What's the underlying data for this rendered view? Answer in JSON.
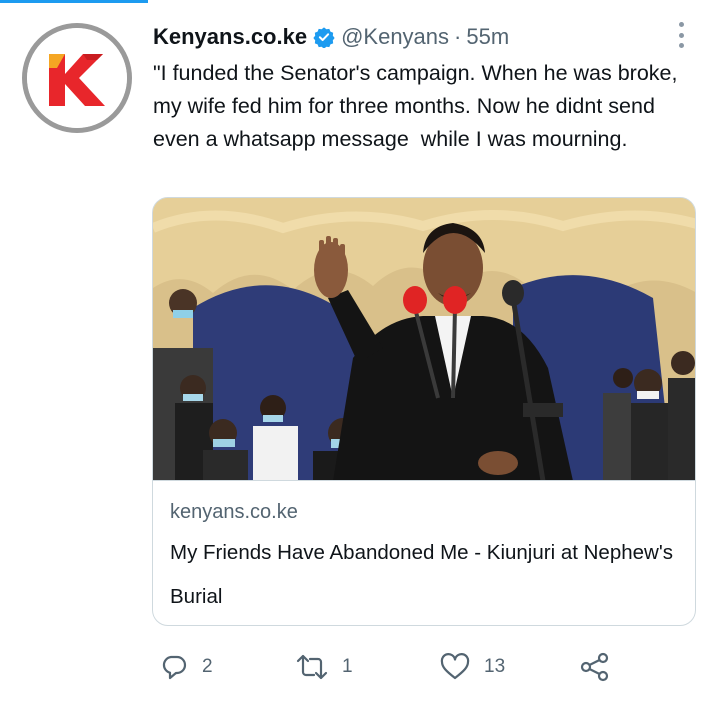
{
  "tweet": {
    "display_name": "Kenyans.co.ke",
    "verified": true,
    "handle": "@Kenyans",
    "separator": "·",
    "time": "55m",
    "text": "\"I funded the Senator's campaign. When he was broke, my wife fed him for three months. Now he didnt send even a whatsapp message  while I was mourning.",
    "avatar_icon": "kenyans-k-logo",
    "more_icon": "more-vertical-icon"
  },
  "card": {
    "domain": "kenyans.co.ke",
    "title": "My Friends Have Abandoned Me - Kiunjuri at Nephew's Burial",
    "image": "photo-of-speaker-at-podium-with-microphones"
  },
  "actions": {
    "reply": {
      "icon": "reply-icon",
      "count": "2"
    },
    "retweet": {
      "icon": "retweet-icon",
      "count": "1"
    },
    "like": {
      "icon": "heart-icon",
      "count": "13"
    },
    "share": {
      "icon": "share-icon"
    }
  },
  "colors": {
    "accent": "#1d9bf0",
    "text_primary": "#0f1419",
    "text_secondary": "#536471",
    "border": "#cfd9de",
    "logo_red": "#e8262b",
    "logo_ring": "#9a9a9a"
  }
}
